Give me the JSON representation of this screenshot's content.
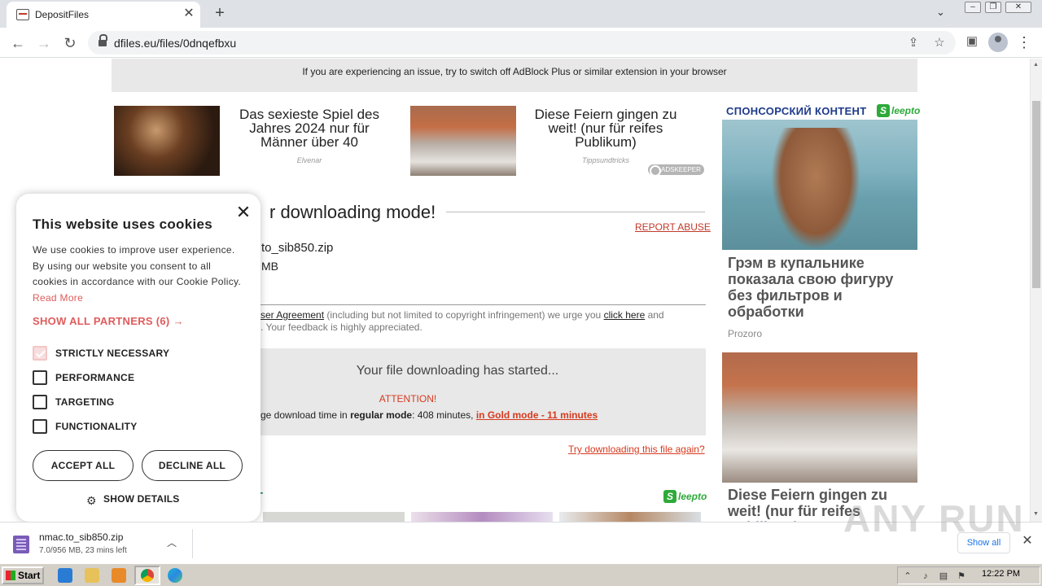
{
  "browser": {
    "tab_title": "DepositFiles",
    "url": "dfiles.eu/files/0dnqefbxu"
  },
  "page": {
    "adblock_notice": "If you are experiencing an issue, try to switch off AdBlock Plus or similar extension in your browser",
    "ads": [
      {
        "title": "Das sexieste Spiel des Jahres 2024 nur für Männer über 40",
        "source": "Elvenar"
      },
      {
        "title": "Diese Feiern gingen zu weit! (nur für reifes Publikum)",
        "source": "Tippsundtricks"
      }
    ],
    "adskeeper_label": "ADSKEEPER",
    "headline": "r downloading mode!",
    "report_abuse": "REPORT ABUSE",
    "file_name": "to_sib850.zip",
    "file_size": "MB",
    "agreement_prefix": "ser Agreement",
    "agreement_mid": " (including but not limited to copyright infringement) we urge you ",
    "agreement_link": "click here",
    "agreement_suffix": " and",
    "agreement_line2": ". Your feedback is highly appreciated.",
    "download_started": "Your file downloading has started...",
    "attention": "ATTENTION!",
    "avg_time_prefix": "ge download time in ",
    "regular_mode": "regular mode",
    "avg_time_mid": ": 408 minutes, ",
    "gold_mode": "in Gold mode - 11 minutes",
    "try_again": "Try downloading this file again?",
    "partners_tail": "T",
    "sleepto_brand": "leepto"
  },
  "sidebar": {
    "sponsored": "СПОНСОРСКИЙ КОНТЕНТ",
    "brand": "leepto",
    "item1_title": "Грэм в купальнике показала свою фигуру без фильтров и обработки",
    "item1_source": "Prozoro",
    "item2_title": "Diese Feiern gingen zu weit! (nur für reifes Publikum)"
  },
  "cookie": {
    "title": "This website uses cookies",
    "text": "We use cookies to improve user experience. By using our website you consent to all cookies in accordance with our Cookie Policy.",
    "read_more": "Read More",
    "partners": "SHOW ALL PARTNERS (6) →",
    "options": [
      {
        "label": "STRICTLY NECESSARY",
        "checked": true,
        "disabled": true
      },
      {
        "label": "PERFORMANCE",
        "checked": false
      },
      {
        "label": "TARGETING",
        "checked": false
      },
      {
        "label": "FUNCTIONALITY",
        "checked": false
      }
    ],
    "accept": "ACCEPT ALL",
    "decline": "DECLINE ALL",
    "details": "SHOW DETAILS"
  },
  "download_shelf": {
    "file": "nmac.to_sib850.zip",
    "status": "7.0/956 MB, 23 mins left",
    "show_all": "Show all",
    "watermark": "ANY RUN"
  },
  "taskbar": {
    "start": "Start",
    "clock": "12:22 PM"
  }
}
